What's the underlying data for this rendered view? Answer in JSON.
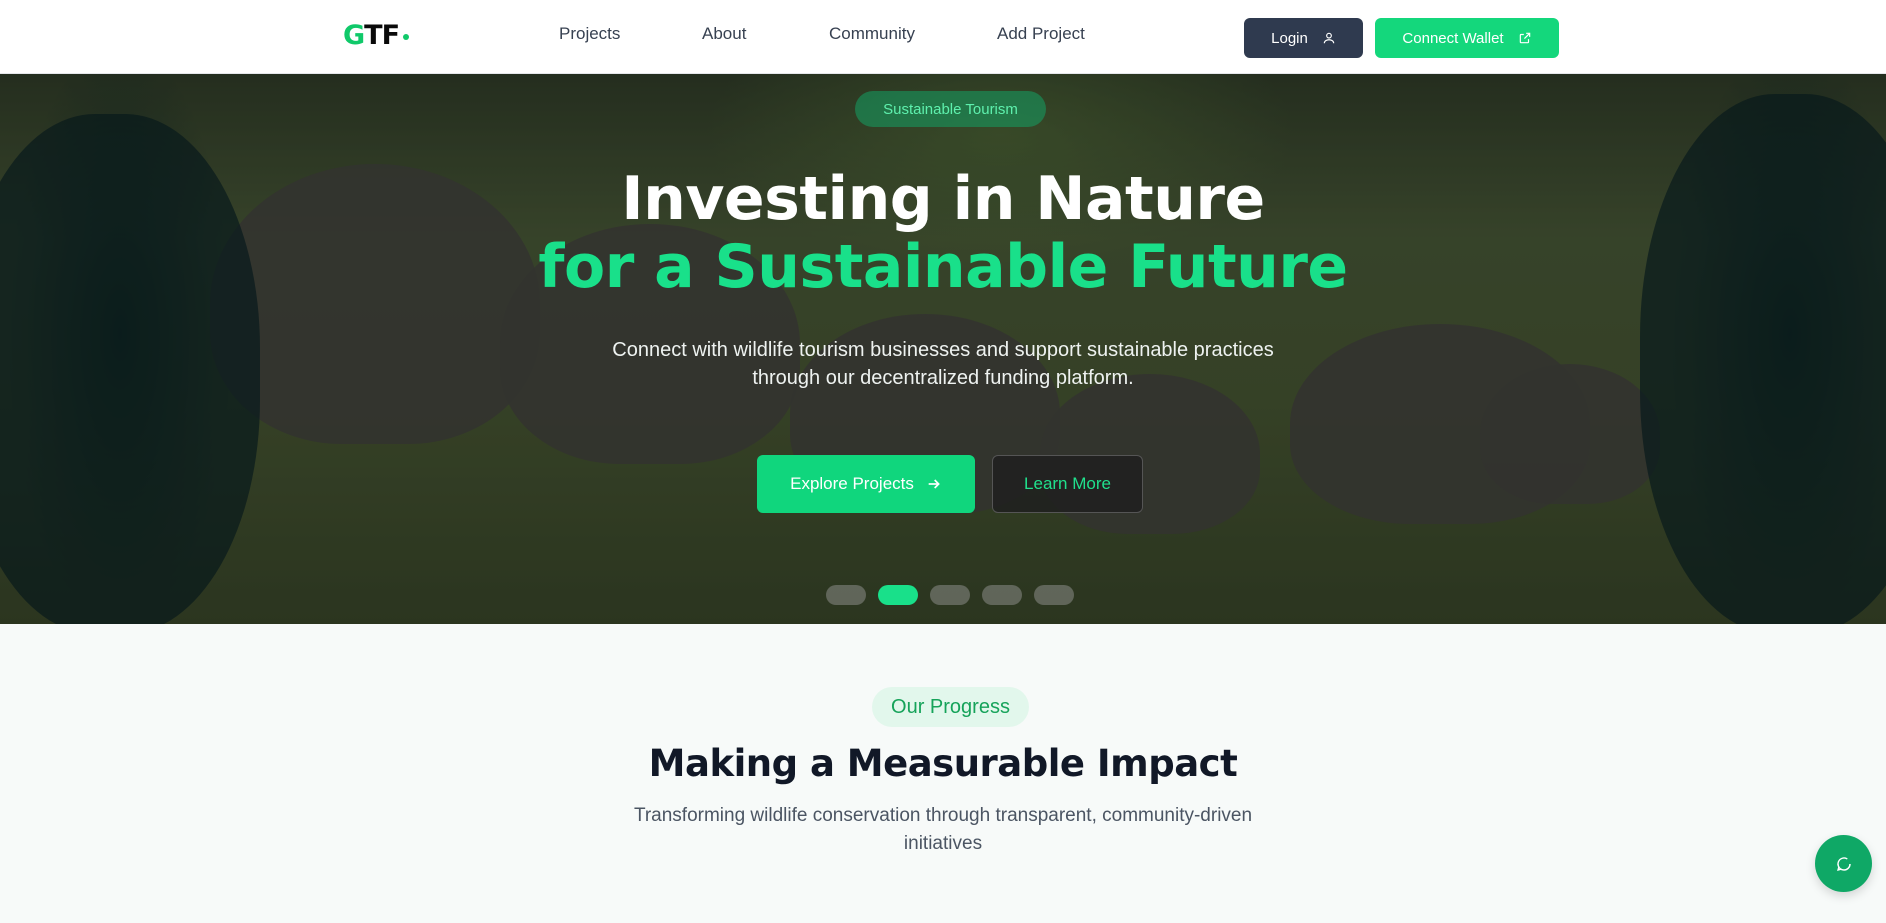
{
  "nav": {
    "logo_g": "G",
    "logo_rest": "TF",
    "links": [
      "Projects",
      "About",
      "Community",
      "Add Project"
    ],
    "login_label": "Login",
    "wallet_label": "Connect Wallet"
  },
  "hero": {
    "tag": "Sustainable Tourism",
    "title_line1": "Investing in Nature",
    "title_line2": "for a Sustainable Future",
    "subtitle": "Connect with wildlife tourism businesses and support sustainable practices through our decentralized funding platform.",
    "explore_label": "Explore Projects",
    "learn_label": "Learn More",
    "slides_count": 5,
    "active_slide": 2
  },
  "progress": {
    "pill": "Our Progress",
    "title": "Making a Measurable Impact",
    "subtitle": "Transforming wildlife conservation through transparent, community-driven initiatives"
  },
  "colors": {
    "accent": "#14d77c",
    "dark_button": "#2f3a4f",
    "fab": "#0fa866"
  }
}
